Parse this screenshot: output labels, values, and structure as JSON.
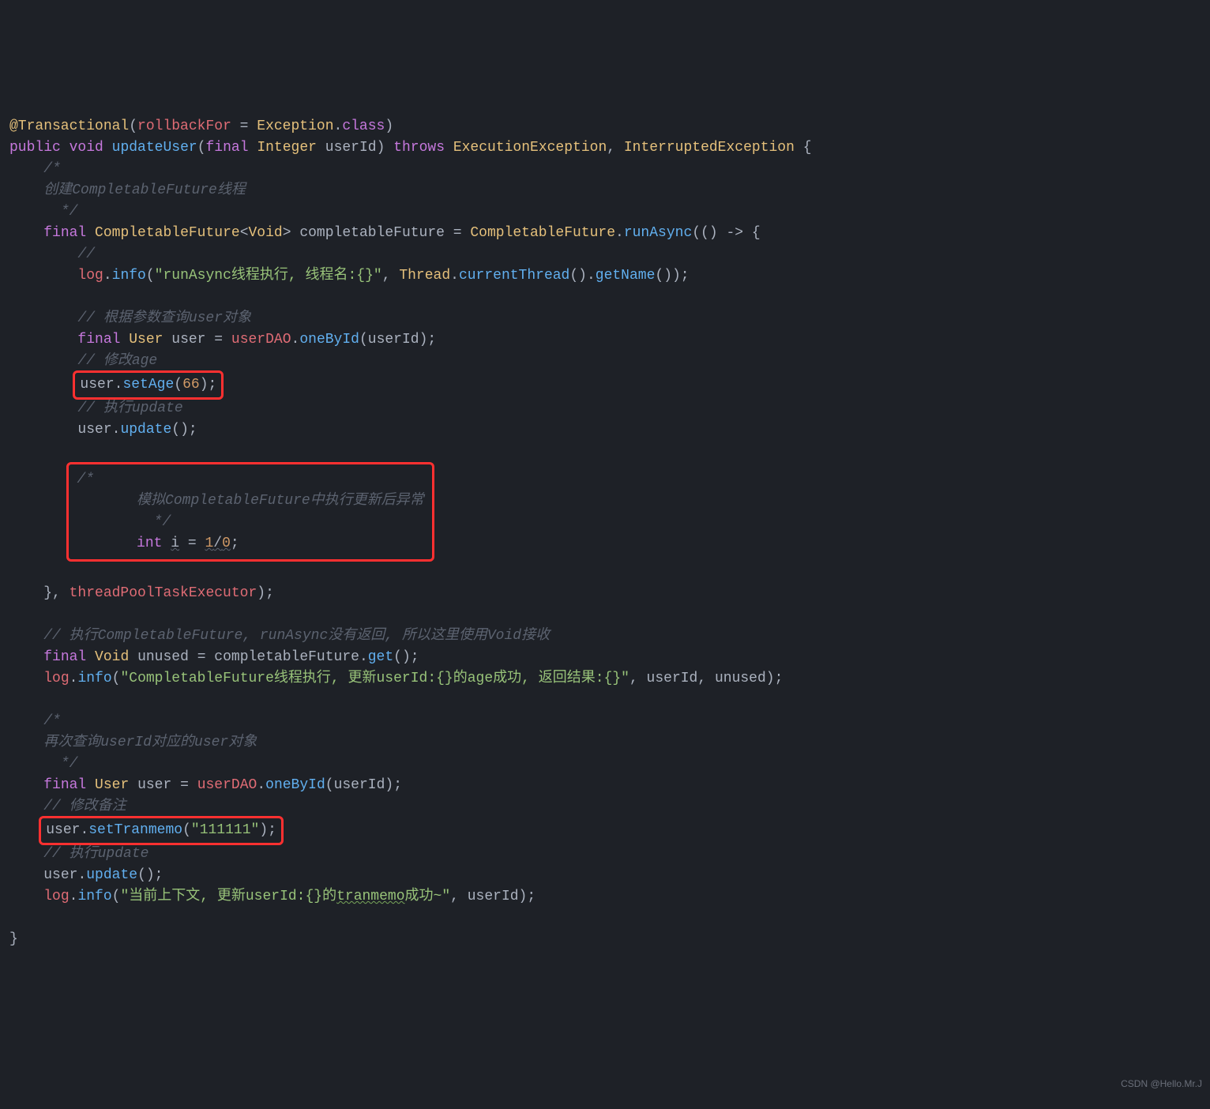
{
  "code": {
    "l1": {
      "annotation": "@Transactional",
      "p1": "(",
      "arg": "rollbackFor",
      "eq": " = ",
      "type1": "Exception",
      "dot": ".",
      "cls": "class",
      "p2": ")"
    },
    "l2": {
      "kw1": "public",
      "kw2": "void",
      "method": "updateUser",
      "p1": "(",
      "kw3": "final",
      "type": "Integer",
      "param": "userId",
      "p2": ") ",
      "kw4": "throws",
      "ex1": "ExecutionException",
      "comma": ", ",
      "ex2": "InterruptedException",
      "brace": " {"
    },
    "l3": "/*",
    "l4": "创建CompletableFuture线程",
    "l5": " */",
    "l6": {
      "kw1": "final",
      "type1": "CompletableFuture",
      "lt": "<",
      "type2": "Void",
      "gt": "> ",
      "var": "completableFuture",
      "eq": " = ",
      "type3": "CompletableFuture",
      "dot": ".",
      "meth": "runAsync",
      "p1": "(() -> {"
    },
    "l7": "//",
    "l8": {
      "obj": "log",
      "dot": ".",
      "meth": "info",
      "p1": "(",
      "str": "\"runAsync线程执行, 线程名:{}\"",
      "c": ", ",
      "type": "Thread",
      "dot2": ".",
      "meth2": "currentThread",
      "p2": "().",
      "meth3": "getName",
      "p3": "());"
    },
    "l9": "// 根据参数查询user对象",
    "l10": {
      "kw": "final",
      "type": "User",
      "var": "user",
      "eq": " = ",
      "obj": "userDAO",
      "dot": ".",
      "meth": "oneById",
      "p1": "(",
      "arg": "userId",
      "p2": ");"
    },
    "l11": "// 修改age",
    "l12": {
      "obj": "user",
      "dot": ".",
      "meth": "setAge",
      "p1": "(",
      "num": "66",
      "p2": ");"
    },
    "l13": "// 执行update",
    "l14": {
      "obj": "user",
      "dot": ".",
      "meth": "update",
      "p": "();"
    },
    "l15": "/*",
    "l16": "模拟CompletableFuture中执行更新后异常",
    "l17": " */",
    "l18": {
      "kw": "int",
      "var": "i",
      "eq": " = ",
      "n1": "1",
      "slash": "/",
      "n2": "0",
      "semi": ";"
    },
    "l19": {
      "close": "}, ",
      "arg": "threadPoolTaskExecutor",
      "p": ");"
    },
    "l20": "// 执行CompletableFuture, runAsync没有返回, 所以这里使用Void接收",
    "l21": {
      "kw": "final",
      "type": "Void",
      "var": "unused",
      "eq": " = ",
      "obj": "completableFuture",
      "dot": ".",
      "meth": "get",
      "p": "();"
    },
    "l22": {
      "obj": "log",
      "dot": ".",
      "meth": "info",
      "p1": "(",
      "str": "\"CompletableFuture线程执行, 更新userId:{}的age成功, 返回结果:{}\"",
      "c": ", ",
      "a1": "userId",
      "c2": ", ",
      "a2": "unused",
      "p2": ");"
    },
    "l23": "/*",
    "l24": "再次查询userId对应的user对象",
    "l25": " */",
    "l26": {
      "kw": "final",
      "type": "User",
      "var": "user",
      "eq": " = ",
      "obj": "userDAO",
      "dot": ".",
      "meth": "oneById",
      "p1": "(",
      "arg": "userId",
      "p2": ");"
    },
    "l27": "// 修改备注",
    "l28": {
      "obj": "user",
      "dot": ".",
      "meth": "setTranmemo",
      "p1": "(",
      "str": "\"111111\"",
      "p2": ");"
    },
    "l29": "// 执行update",
    "l30": {
      "obj": "user",
      "dot": ".",
      "meth": "update",
      "p": "();"
    },
    "l31": {
      "obj": "log",
      "dot": ".",
      "meth": "info",
      "p1": "(",
      "str1": "\"当前上下文, 更新userId:{}的",
      "wavy": "tranmemo",
      "str2": "成功~\"",
      "c": ", ",
      "a": "userId",
      "p2": ");"
    },
    "l32": "}"
  },
  "watermark": "CSDN @Hello.Mr.J"
}
